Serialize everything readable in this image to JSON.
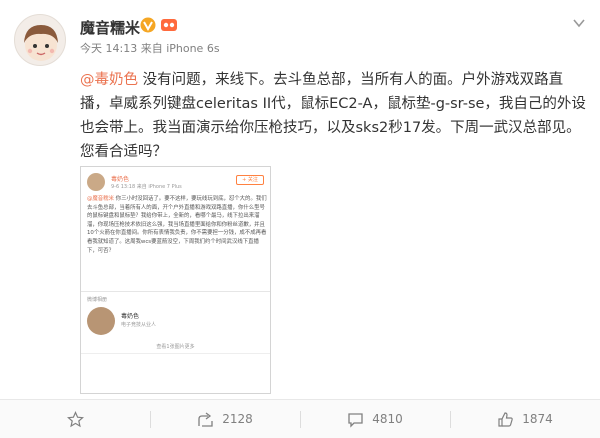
{
  "post": {
    "username": "魔音糯米",
    "meta": "今天 14:13 来自 iPhone 6s",
    "mention": "@毒奶色",
    "text": " 没有问题，来线下。去斗鱼总部，当所有人的面。户外游戏双路直播，卓威系列键盘celeritas II代，鼠标EC2-A，鼠标垫-g-sr-se，我自己的外设也会带上。我当面演示给你压枪技巧，以及sks2秒17发。下周一武汉总部见。您看合适吗？"
  },
  "quoted": {
    "name": "毒奶色",
    "time": "9-6 13:18 来自 iPhone 7 Plus",
    "follow": "+ 关注",
    "mention": "@魔音糯米",
    "text": " 你三小时没回话了。要不这样，要玩线玩到底，怼个大的。我们去斗鱼总部，当着所有人的面，开个户外直播和游戏双路直播，你什么型号的鼠标键盘和鼠标垫？我给你带上，全新的，看哪个最马，线下拉出来溜溜，你现场压枪技术依旧这么强，我当场直播里面给你和你粉丝道歉，并且10个火箭在你直播间。你所有表情我负责，你不需要担一分钱，成不成再看看我就知道了。这周我wcs要蓝箭没空，下周我们约个时间武汉线下直播下，可否？",
    "section_label": "微博相册",
    "card_name": "毒奶色",
    "card_desc": "电子竞技从业人",
    "more": "查看1张图片更多"
  },
  "actions": {
    "share_count": "2128",
    "comment_count": "4810",
    "like_count": "1874"
  },
  "colors": {
    "accent": "#eb7350",
    "muted": "#808080"
  }
}
